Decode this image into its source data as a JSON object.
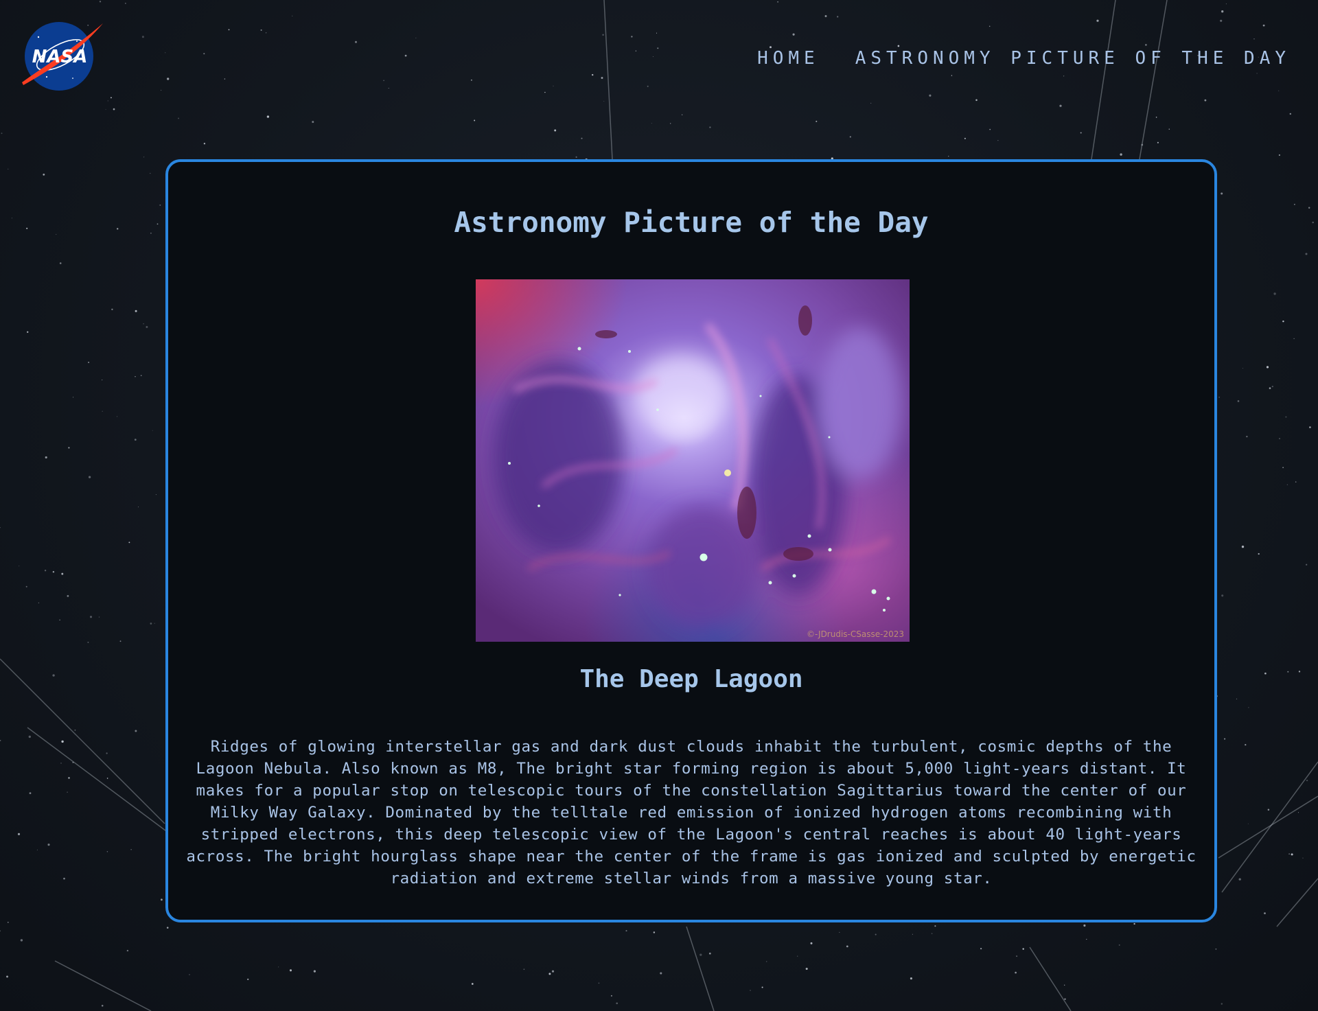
{
  "header": {
    "logo_text": "NASA",
    "nav": [
      {
        "label": "HOME"
      },
      {
        "label": "ASTRONOMY PICTURE OF THE DAY"
      }
    ]
  },
  "apod": {
    "heading": "Astronomy Picture of the Day",
    "image_title": "The Deep Lagoon",
    "image_credit": "©-JDrudis-CSasse-2023",
    "explanation": "Ridges of glowing interstellar gas and dark dust clouds inhabit the turbulent, cosmic depths of the Lagoon Nebula. Also known as M8, The bright star forming region is about 5,000 light-years distant. It makes for a popular stop on telescopic tours of the constellation Sagittarius toward the center of our Milky Way Galaxy. Dominated by the telltale red emission of ionized hydrogen atoms recombining with stripped electrons, this deep telescopic view of the Lagoon's central reaches is about 40 light-years across. The bright hourglass shape near the center of the frame is gas ionized and sculpted by energetic radiation and extreme stellar winds from a massive young star."
  },
  "colors": {
    "accent_border": "#2a86e0",
    "text": "#a9c3e6",
    "card_bg": "#090d12",
    "page_bg": "#12171e"
  }
}
